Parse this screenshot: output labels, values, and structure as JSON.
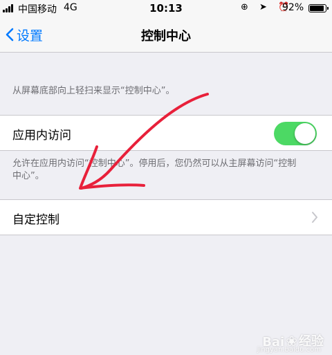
{
  "status_bar": {
    "carrier": "中国移动",
    "network": "4G",
    "time": "10:13",
    "icons": "⊕ ➤ ⏰",
    "battery_percent": "92%",
    "battery_level": 0.92
  },
  "nav": {
    "back_label": "设置",
    "title": "控制中心"
  },
  "footer_note_1": "从屏幕底部向上轻扫来显示“控制中心”。",
  "access_cell": {
    "label": "应用内访问",
    "toggle_on": true,
    "note": "允许在应用内访问“控制中心”。停用后，您仍然可以从主屏幕访问“控制中心”。"
  },
  "custom_cell": {
    "label": "自定控制"
  },
  "watermark": {
    "brand_left": "Bai",
    "brand_right": "经验",
    "sub": "jingyan.baidu.com"
  },
  "colors": {
    "accent": "#007aff",
    "toggle_on": "#4cd964",
    "annotation": "#e8203a",
    "background": "#efeff4"
  }
}
